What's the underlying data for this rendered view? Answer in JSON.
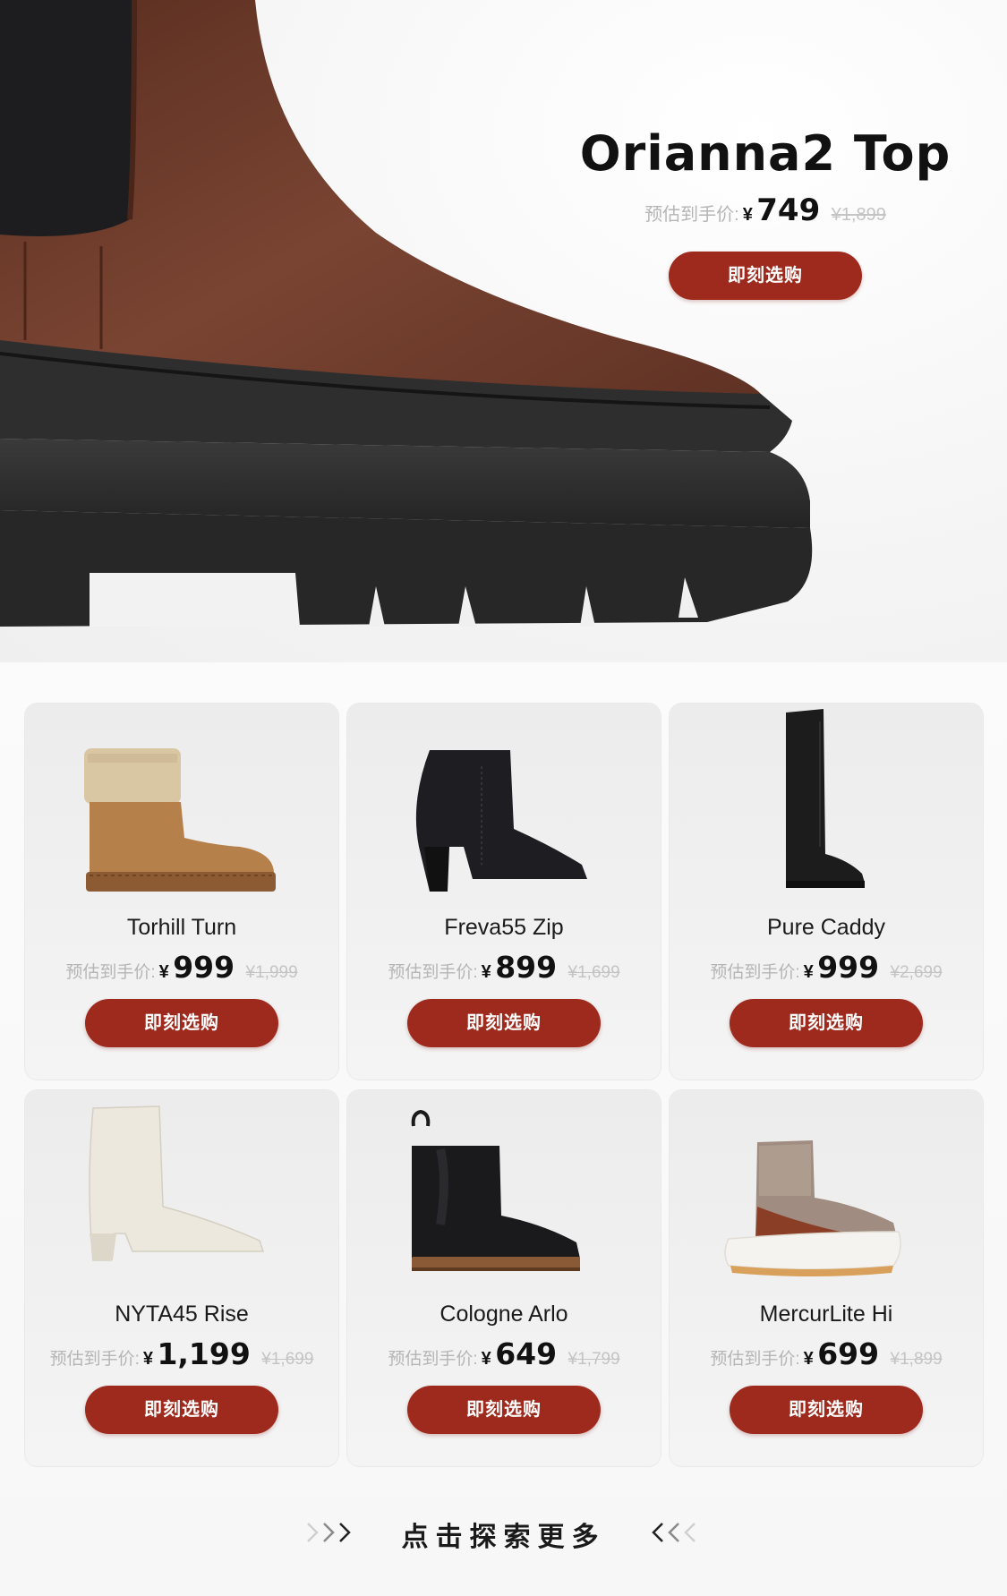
{
  "hero": {
    "title": "Orianna2 Top",
    "price_label": "预估到手价:",
    "currency": "¥",
    "price": "749",
    "original_price": "¥1,899",
    "button_label": "即刻选购"
  },
  "products": [
    {
      "name": "Torhill Turn",
      "price_label": "预估到手价:",
      "currency": "¥",
      "price": "999",
      "original_price": "¥1,999",
      "button_label": "即刻选购"
    },
    {
      "name": "Freva55 Zip",
      "price_label": "预估到手价:",
      "currency": "¥",
      "price": "899",
      "original_price": "¥1,699",
      "button_label": "即刻选购"
    },
    {
      "name": "Pure Caddy",
      "price_label": "预估到手价:",
      "currency": "¥",
      "price": "999",
      "original_price": "¥2,699",
      "button_label": "即刻选购"
    },
    {
      "name": "NYTA45 Rise",
      "price_label": "预估到手价:",
      "currency": "¥",
      "price": "1,199",
      "original_price": "¥1,699",
      "button_label": "即刻选购"
    },
    {
      "name": "Cologne Arlo",
      "price_label": "预估到手价:",
      "currency": "¥",
      "price": "649",
      "original_price": "¥1,799",
      "button_label": "即刻选购"
    },
    {
      "name": "MercurLite Hi",
      "price_label": "预估到手价:",
      "currency": "¥",
      "price": "699",
      "original_price": "¥1,899",
      "button_label": "即刻选购"
    }
  ],
  "footer": {
    "text": "点击探索更多",
    "left_icon": "double-chevron-right-icon",
    "right_icon": "double-chevron-left-icon"
  },
  "colors": {
    "accent": "#9e2a1e",
    "price_muted": "#b5b5b5",
    "boot_brown": "#6b3a2a",
    "sole_black": "#2b2b2b"
  }
}
